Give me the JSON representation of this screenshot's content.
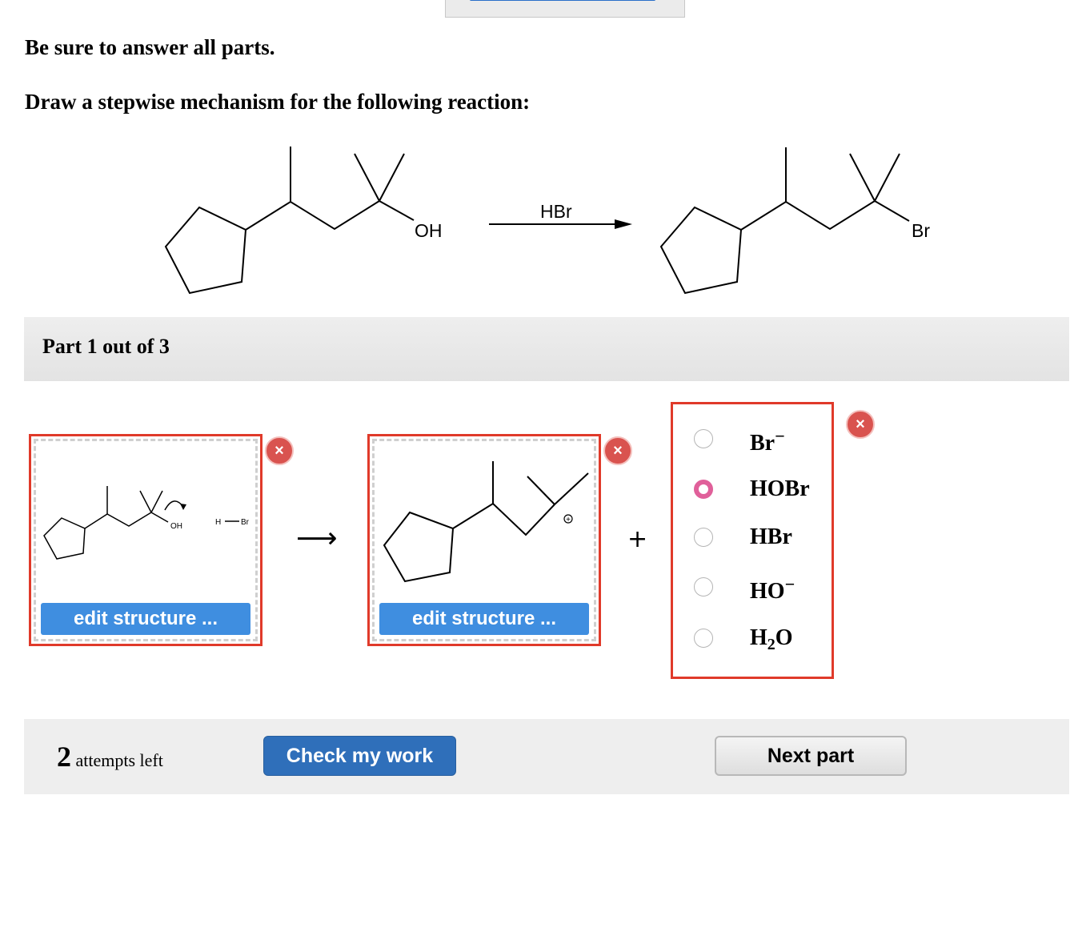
{
  "instructions": {
    "line1": "Be sure to answer all parts.",
    "line2": "Draw a stepwise mechanism for the following reaction:"
  },
  "reaction": {
    "reactant_label": "OH",
    "reagent": "HBr",
    "product_label": "Br"
  },
  "part_header": "Part 1 out of 3",
  "slot1": {
    "oh_label": "OH",
    "h_label": "H",
    "br_label": "Br",
    "edit_label": "edit structure ..."
  },
  "slot2": {
    "edit_label": "edit structure ...",
    "charge": "+"
  },
  "close_symbol": "×",
  "arrow_symbol": "⟶",
  "plus_symbol": "+",
  "choices": [
    {
      "text": "Br",
      "sup": "−",
      "sub": "",
      "tail": "",
      "selected": false
    },
    {
      "text": "HOBr",
      "sup": "",
      "sub": "",
      "tail": "",
      "selected": true
    },
    {
      "text": "HBr",
      "sup": "",
      "sub": "",
      "tail": "",
      "selected": false
    },
    {
      "text": "HO",
      "sup": "−",
      "sub": "",
      "tail": "",
      "selected": false
    },
    {
      "text": "H",
      "sup": "",
      "sub": "2",
      "tail": "O",
      "selected": false
    }
  ],
  "footer": {
    "attempts_count": "2",
    "attempts_text": "attempts left",
    "check_label": "Check my work",
    "next_label": "Next part"
  },
  "colors": {
    "accent_red": "#e03a2a",
    "button_blue": "#3f8ee0",
    "check_blue": "#2f6fba",
    "radio_pink": "#e0609a",
    "close_red": "#d9534f"
  }
}
